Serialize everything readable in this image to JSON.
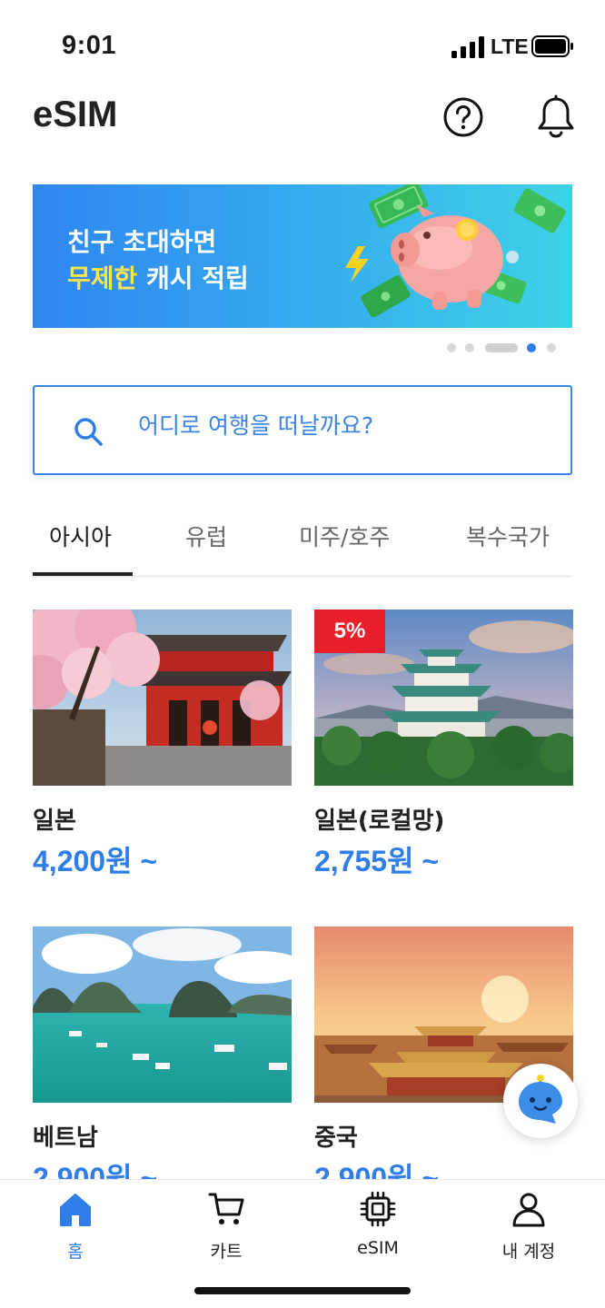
{
  "status_bar": {
    "time": "9:01",
    "network": "LTE"
  },
  "header": {
    "title": "eSIM",
    "help_icon": "help-circle-icon",
    "notification_icon": "bell-icon"
  },
  "banner": {
    "line1": "친구 초대하면",
    "line2_highlight": "무제한",
    "line2_rest": " 캐시 적립",
    "highlight_color": "#ffe44d",
    "page_count": 5,
    "active_page": 4
  },
  "search": {
    "placeholder": "어디로 여행을 떠날까요?"
  },
  "tabs": [
    {
      "label": "아시아",
      "active": true
    },
    {
      "label": "유럽",
      "active": false
    },
    {
      "label": "미주/호주",
      "active": false
    },
    {
      "label": "복수국가",
      "active": false
    }
  ],
  "products": [
    {
      "name": "일본",
      "price": "4,200원 ~",
      "badge": ""
    },
    {
      "name": "일본(로컬망)",
      "price": "2,755원 ~",
      "badge": "5%"
    },
    {
      "name": "베트남",
      "price": "2,900원 ~",
      "badge": ""
    },
    {
      "name": "중국",
      "price": "2,900원 ~",
      "badge": ""
    }
  ],
  "bottom_nav": [
    {
      "label": "홈",
      "icon": "home-icon",
      "active": true
    },
    {
      "label": "카트",
      "icon": "cart-icon",
      "active": false
    },
    {
      "label": "eSIM",
      "icon": "chip-icon",
      "active": false
    },
    {
      "label": "내 계정",
      "icon": "user-icon",
      "active": false
    }
  ],
  "colors": {
    "accent": "#2f7de8",
    "badge": "#e8202b"
  }
}
